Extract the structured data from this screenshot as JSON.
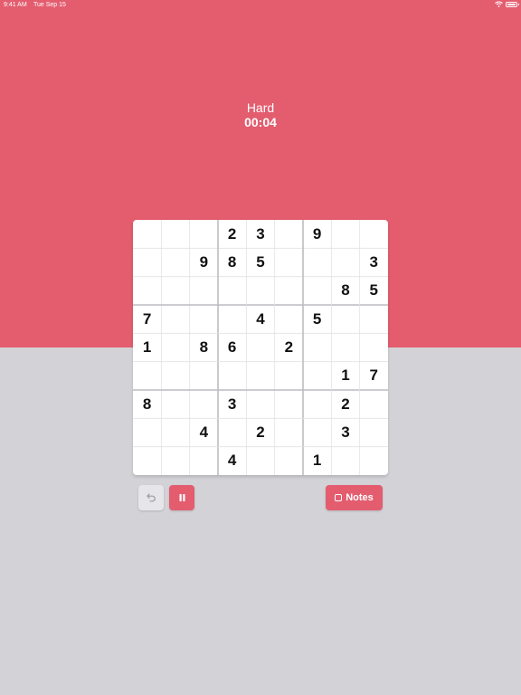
{
  "status_bar": {
    "time": "9:41 AM",
    "date": "Tue Sep 15"
  },
  "game": {
    "difficulty": "Hard",
    "timer": "00:04"
  },
  "board": [
    [
      "",
      "",
      "",
      "2",
      "3",
      "",
      "9",
      "",
      ""
    ],
    [
      "",
      "",
      "9",
      "8",
      "5",
      "",
      "",
      "",
      "3"
    ],
    [
      "",
      "",
      "",
      "",
      "",
      "",
      "",
      "8",
      "5"
    ],
    [
      "7",
      "",
      "",
      "",
      "4",
      "",
      "5",
      "",
      ""
    ],
    [
      "1",
      "",
      "8",
      "6",
      "",
      "2",
      "",
      "",
      ""
    ],
    [
      "",
      "",
      "",
      "",
      "",
      "",
      "",
      "1",
      "7"
    ],
    [
      "8",
      "",
      "",
      "3",
      "",
      "",
      "",
      "2",
      ""
    ],
    [
      "",
      "",
      "4",
      "",
      "2",
      "",
      "",
      "3",
      ""
    ],
    [
      "",
      "",
      "",
      "4",
      "",
      "",
      "1",
      "",
      ""
    ]
  ],
  "controls": {
    "undo_icon": "undo-arrow-icon",
    "pause_icon": "pause-icon",
    "notes_label": "Notes",
    "notes_icon": "checkbox-icon"
  },
  "colors": {
    "accent": "#e35d6f",
    "background_bottom": "#d3d2d7",
    "grid_thin": "#e2e2e5",
    "grid_thick": "#bdbcc2"
  }
}
